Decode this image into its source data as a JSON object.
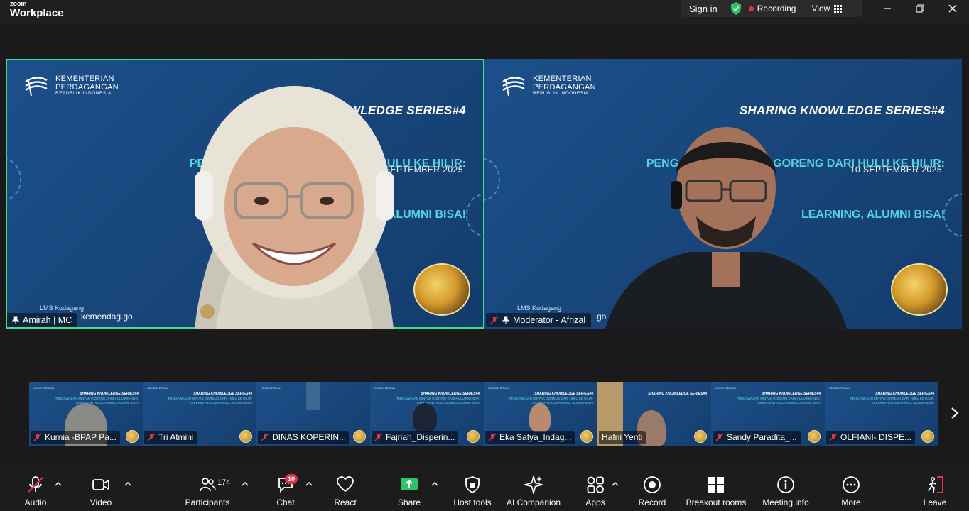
{
  "app": {
    "brand_small": "zoom",
    "brand_big": "Workplace"
  },
  "titlebar": {
    "signin": "Sign in",
    "recording": "Recording",
    "view": "View"
  },
  "slide": {
    "logo_line1": "KEMENTERIAN",
    "logo_line2": "PERDAGANGAN",
    "logo_line3": "REPUBLIK INDONESIA",
    "title": "SHARING KNOWLEDGE SERIES#4",
    "title_left_visible": "WLEDGE SERIES#4",
    "sub1": "PENGAWASAN MINYAK GORENG DARI HULU KE HILIR:",
    "sub2": "EXPERIENTIAL LEARNING, ALUMNI BISA!",
    "sub1_left_visible": "PENGAWASAN M                              HULU KE HILIR:",
    "sub2_left_visible": "EX                                              ALUMNI BISA!",
    "sub1_right_visible": "PENGAWASAN MINYA  GORENG DARI HULU KE HILIR:",
    "sub2_right_visible": "EXPE                      LEARNING, ALUMNI BISA!",
    "date": "10 SEPTEMBER 2025",
    "lms_label": "LMS Kudagang",
    "lms_url_left": "kemendag.go",
    "lms_url_right": "go"
  },
  "speakers": [
    {
      "name": "Amirah | MC",
      "active": true
    },
    {
      "name": "Moderator - Afrizal",
      "active": false
    }
  ],
  "thumbnails": [
    {
      "name": "Kurnia -BPAP Pa..."
    },
    {
      "name": "Tri Atmini"
    },
    {
      "name": "DINAS KOPERIN..."
    },
    {
      "name": "Fajriah_Disperin..."
    },
    {
      "name": "Eka Satya_Indag..."
    },
    {
      "name": "Hafni Yenti"
    },
    {
      "name": "Sandy Paradita_..."
    },
    {
      "name": "OLFIANI- DISPE..."
    }
  ],
  "toolbar": {
    "audio": "Audio",
    "video": "Video",
    "participants": "Participants",
    "participants_count": "174",
    "chat": "Chat",
    "chat_badge": "10",
    "react": "React",
    "share": "Share",
    "host_tools": "Host tools",
    "ai_companion": "AI Companion",
    "apps": "Apps",
    "record": "Record",
    "breakout": "Breakout rooms",
    "meeting_info": "Meeting info",
    "more": "More",
    "leave": "Leave"
  },
  "colors": {
    "active_border": "#3ee08a",
    "recording_dot": "#e0334a",
    "share_green": "#2ec36a",
    "leave_red": "#e0334a",
    "slide_accent": "#52d5e0"
  }
}
